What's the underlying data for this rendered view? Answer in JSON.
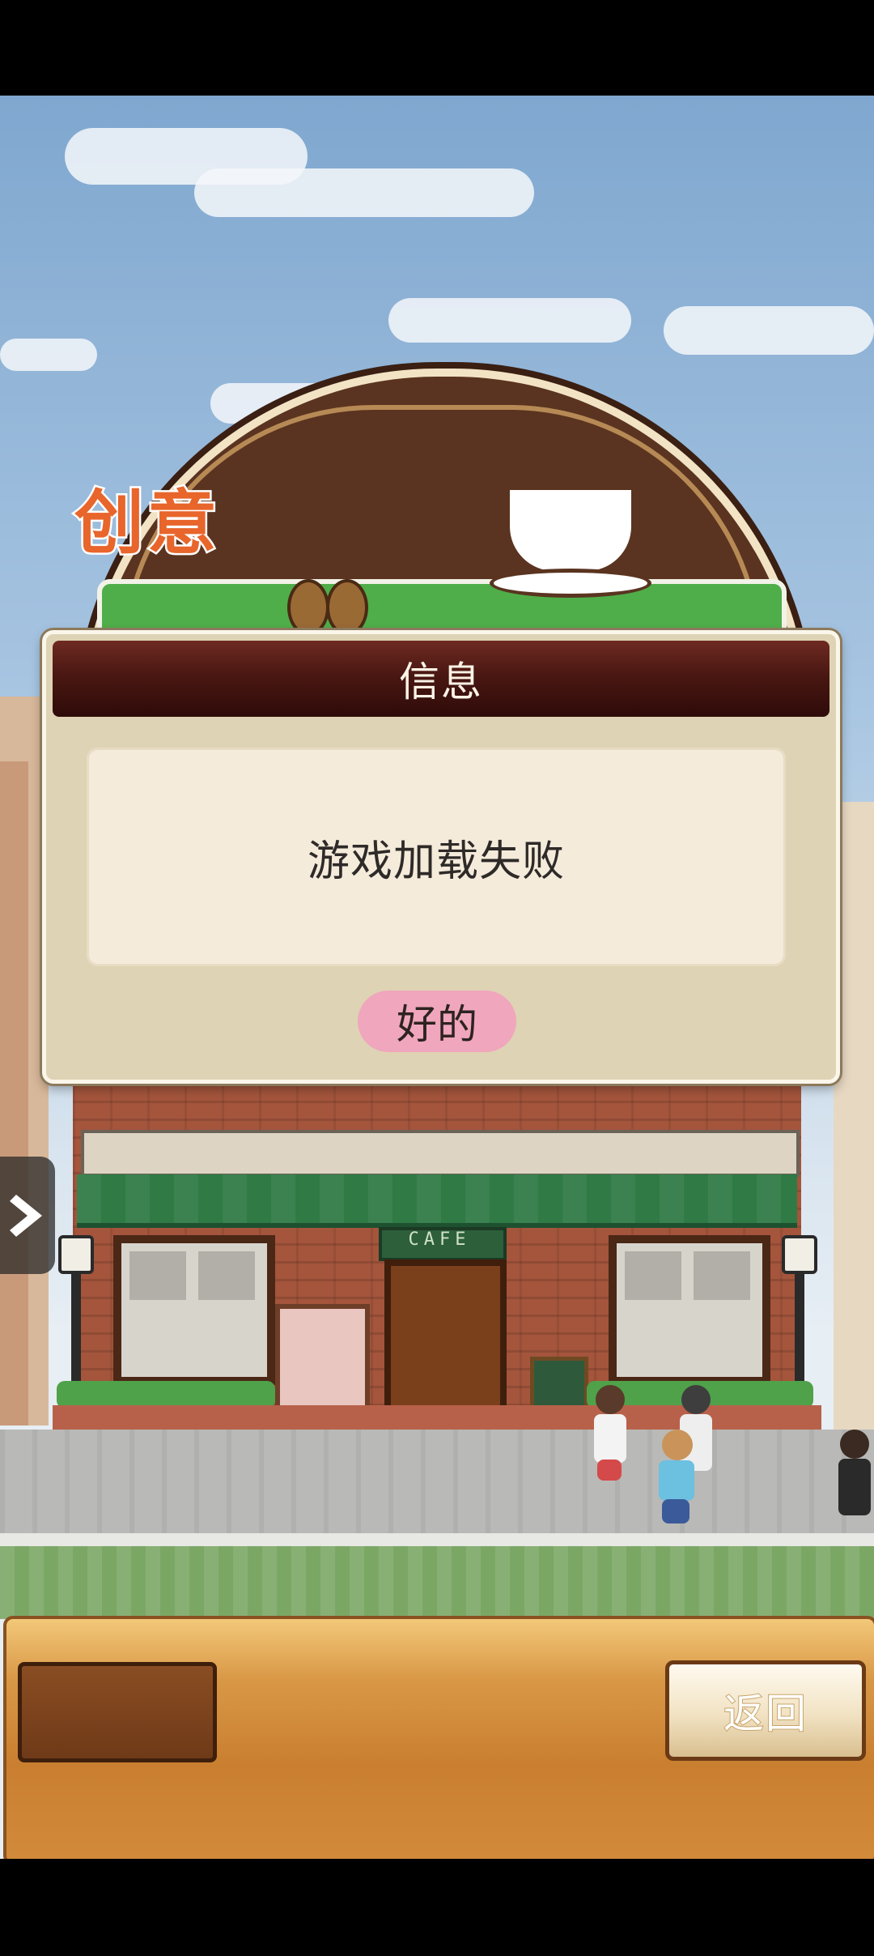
{
  "dialog": {
    "title": "信息",
    "message": "游戏加载失败",
    "ok_label": "好的"
  },
  "logo": {
    "text": "创意",
    "cafe_sign": "CAFE"
  },
  "bottom_bar": {
    "back_label": "返回"
  },
  "icons": {
    "side_toggle": "chevron-right-icon",
    "coffee_cup": "coffee-cup-icon",
    "coffee_beans": "coffee-bean-icon"
  },
  "colors": {
    "dialog_header": "#3a0f0c",
    "dialog_bg": "#ded3b4",
    "ok_button": "#f0a6bd",
    "bottom_panel": "#d99846",
    "awning": "#2f7a45"
  }
}
